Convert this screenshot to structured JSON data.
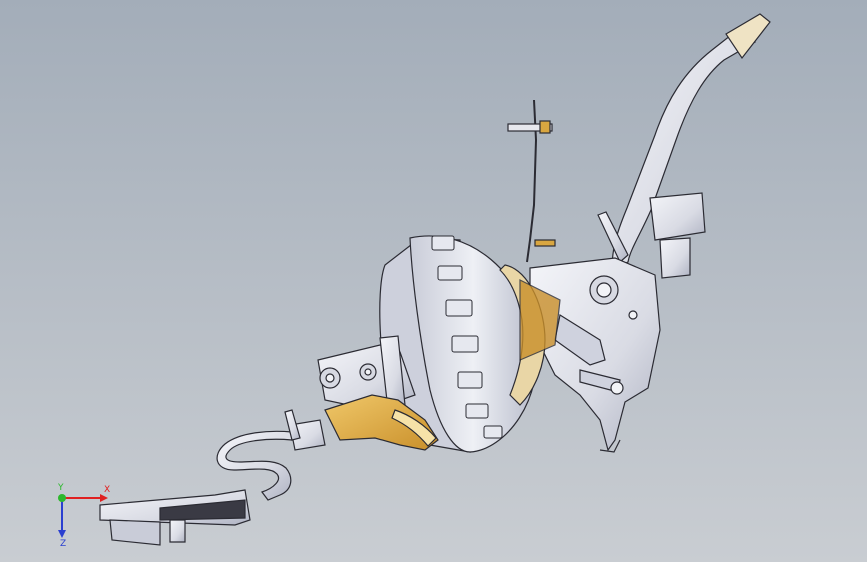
{
  "viewport": {
    "background_top": "#a3adb9",
    "background_bottom": "#c9cdd2"
  },
  "triad": {
    "x_label": "X",
    "y_label": "Y",
    "z_label": "Z",
    "x_color": "#e02020",
    "y_color": "#2db82d",
    "z_color": "#2a3fd0"
  },
  "model": {
    "body_color": "#e6e8ef",
    "shade_color": "#b9bdcc",
    "edge_color": "#2b2b33",
    "accent_color": "#d9a640"
  }
}
